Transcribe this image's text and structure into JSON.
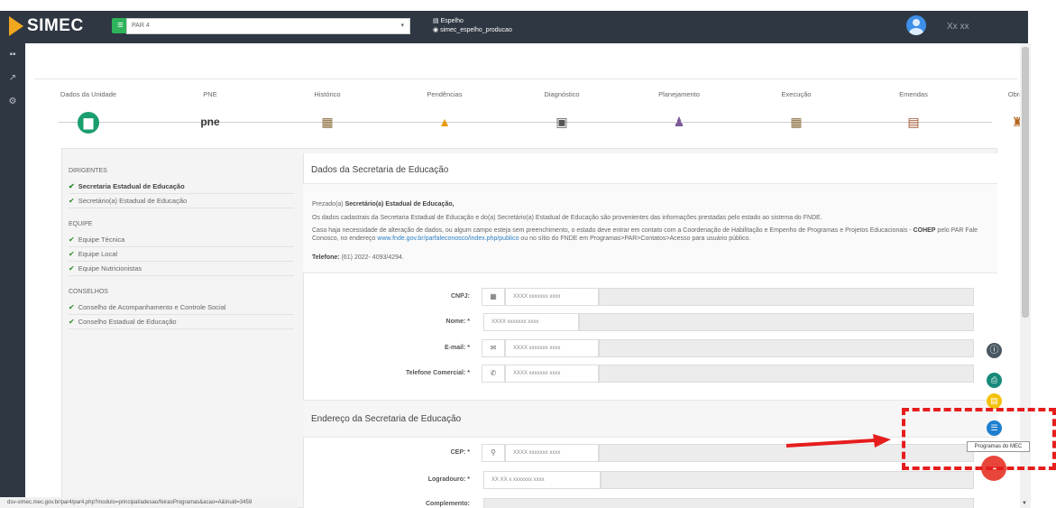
{
  "topbar": {
    "brand": "SIMEC",
    "module_value": "PAR 4",
    "env_label": "Espelho",
    "env_db": "simec_espelho_producao",
    "username": "Xx xx"
  },
  "steps": [
    {
      "label": "Dados da Unidade"
    },
    {
      "label": "PNE"
    },
    {
      "label": "Histórico"
    },
    {
      "label": "Pendências"
    },
    {
      "label": "Diagnóstico"
    },
    {
      "label": "Planejamento"
    },
    {
      "label": "Execução"
    },
    {
      "label": "Emendas"
    },
    {
      "label": "Obras"
    }
  ],
  "pne_text": "pne",
  "leftnav": {
    "sections": [
      {
        "title": "DIRIGENTES",
        "items": [
          "Secretaria Estadual de Educação",
          "Secretário(a) Estadual de Educação"
        ]
      },
      {
        "title": "EQUIPE",
        "items": [
          "Equipe Técnica",
          "Equipe Local",
          "Equipe Nutricionistas"
        ]
      },
      {
        "title": "CONSELHOS",
        "items": [
          "Conselho de Acompanhamento e Controle Social",
          "Conselho Estadual de Educação"
        ]
      }
    ]
  },
  "main": {
    "title1": "Dados da Secretaria de Educação",
    "greeting_prefix": "Prezado(a) ",
    "greeting_bold": "Secretário(a) Estadual de Educação,",
    "info1": "Os dados cadastrais da Secretaria Estadual de Educação e do(a) Secretário(a) Estadual de Educação são provenientes das informações prestadas pelo estado ao sistema do FNDE.",
    "info2_a": "Caso haja necessidade de alteração de dados, ou algum campo esteja sem preenchimento, o estado deve entrar em contato com a Coordenação de Habilitação e Empenho de Programas e Projetos Educacionais - ",
    "info2_bold": "COHEP",
    "info2_b": " pelo PAR Fale Conosco, no endereço ",
    "info2_link": "www.fnde.gov.br/parfaleconosco/index.php/publico",
    "info2_c": " ou no sítio do FNDE em Programas>PAR>Contatos>Acesso para usuário público.",
    "phone_label": "Telefone:",
    "phone_value": "(61) 2022- 4093/4294.",
    "title2": "Endereço da Secretaria de Educação"
  },
  "fields": {
    "cnpj": {
      "label": "CNPJ:",
      "value": "XXXX xxxxxxx xxxx"
    },
    "nome": {
      "label": "Nome: *",
      "value": "XXXX xxxxxxx xxxx"
    },
    "email": {
      "label": "E-mail: *",
      "value": "XXXX xxxxxxx xxxx"
    },
    "telefone": {
      "label": "Telefone Comercial: *",
      "value": "XXXX xxxxxxx xxxx"
    },
    "cep": {
      "label": "CEP: *",
      "value": "XXXX xxxxxxx xxxx"
    },
    "logradouro": {
      "label": "Logradouro: *",
      "value": "XX XX x xxxxxxx xxxx"
    },
    "complemento": {
      "label": "Complemento:"
    }
  },
  "tooltip": "Programas do MEC",
  "status_url": "dsv-simec.mec.gov.br/par4/par4.php?modulo=principal/adesao/feiraoProgramas&acao=A&inuid=3459",
  "colors": {
    "topbar": "#2f3742",
    "accent_green": "#1a9e6e",
    "fab_red": "#e8463a",
    "highlight_red": "#e61d1d"
  }
}
